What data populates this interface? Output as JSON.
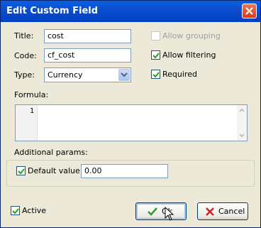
{
  "window": {
    "title": "Edit Custom Field"
  },
  "form": {
    "title_label": "Title:",
    "title_value": "cost",
    "code_label": "Code:",
    "code_value": "cf_cost",
    "type_label": "Type:",
    "type_value": "Currency",
    "allow_grouping_label": "Allow grouping",
    "allow_grouping_checked": false,
    "allow_filtering_label": "Allow filtering",
    "allow_filtering_checked": true,
    "required_label": "Required",
    "required_checked": true,
    "formula_label": "Formula:",
    "formula_line_number": "1",
    "additional_params_label": "Additional params:",
    "default_value_label": "Default value:",
    "default_value_checked": true,
    "default_value": "0.00",
    "active_label": "Active",
    "active_checked": true
  },
  "buttons": {
    "ok_label": "Ok",
    "cancel_label": "Cancel"
  },
  "icons": {
    "close": "close-icon",
    "ok": "green-check-icon",
    "cancel": "red-x-icon",
    "dropdown": "chevron-down-icon",
    "cursor": "mouse-pointer-icon"
  },
  "colors": {
    "titlebar": "#0a4fd0",
    "ok_check": "#2e9e2e",
    "cancel_x": "#d02020",
    "dialog_bg": "#ece9d8"
  }
}
